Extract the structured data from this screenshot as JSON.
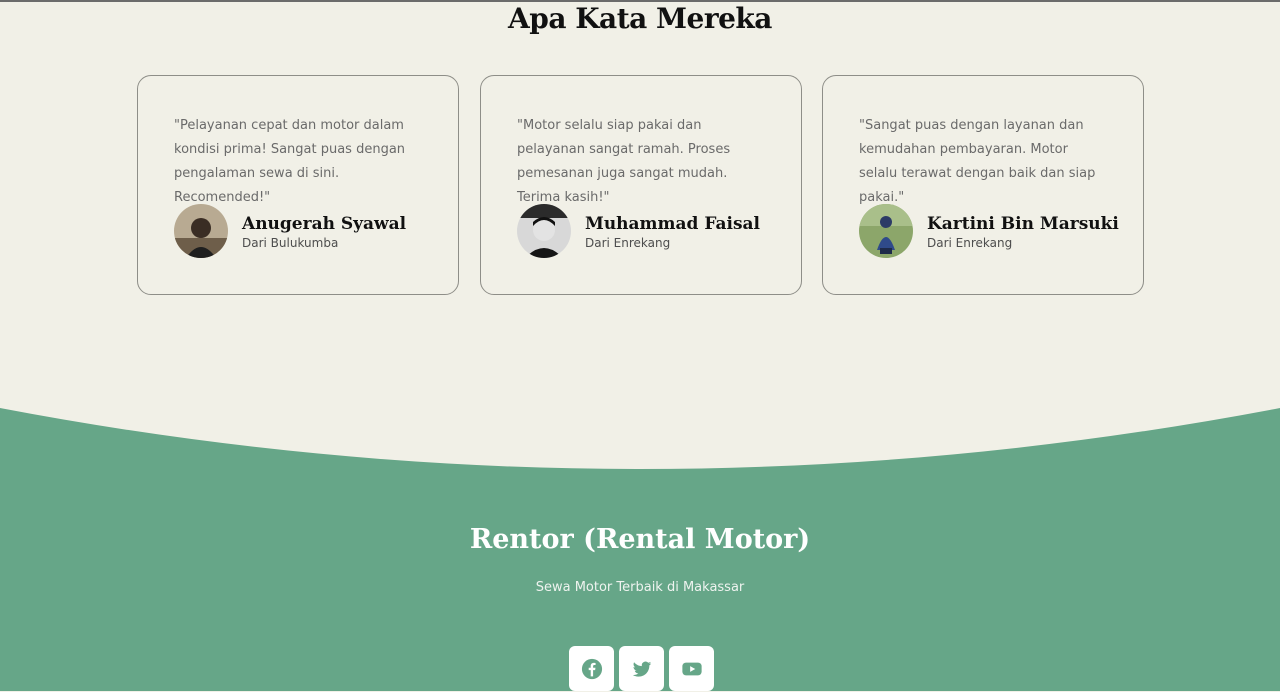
{
  "testimonials": {
    "title": "Apa Kata Mereka",
    "items": [
      {
        "quote": "\"Pelayanan cepat dan motor dalam kondisi prima! Sangat puas dengan pengalaman sewa di sini. Recomended!\"",
        "name": "Anugerah Syawal",
        "origin": "Dari Bulukumba"
      },
      {
        "quote": "\"Motor selalu siap pakai dan pelayanan sangat ramah. Proses pemesanan juga sangat mudah. Terima kasih!\"",
        "name": "Muhammad Faisal",
        "origin": "Dari Enrekang"
      },
      {
        "quote": "\"Sangat puas dengan layanan dan kemudahan pembayaran. Motor selalu terawat dengan baik dan siap pakai.\"",
        "name": "Kartini Bin Marsuki",
        "origin": "Dari Enrekang"
      }
    ]
  },
  "footer": {
    "brand": "Rentor (Rental Motor)",
    "tagline": "Sewa Motor Terbaik di Makassar",
    "socials": [
      {
        "icon": "facebook-icon"
      },
      {
        "icon": "twitter-icon"
      },
      {
        "icon": "youtube-icon"
      }
    ]
  },
  "colors": {
    "background": "#f1f0e7",
    "footer": "#66a688",
    "heading": "#111111"
  }
}
